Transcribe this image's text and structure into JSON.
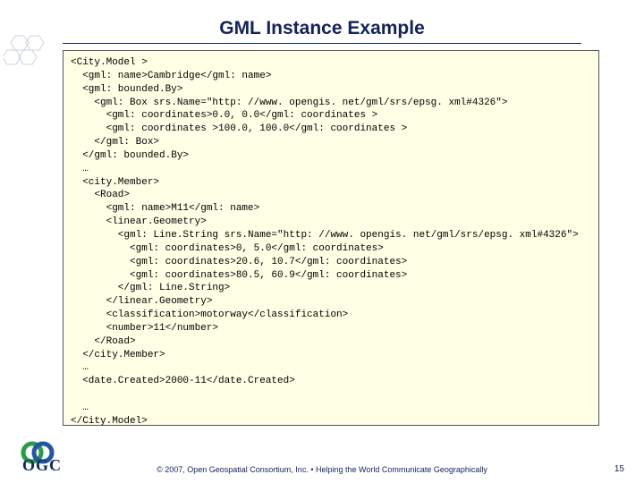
{
  "title": "GML Instance Example",
  "code": "<City.Model >\n  <gml: name>Cambridge</gml: name>\n  <gml: bounded.By>\n    <gml: Box srs.Name=\"http: //www. opengis. net/gml/srs/epsg. xml#4326\">\n      <gml: coordinates>0.0, 0.0</gml: coordinates >\n      <gml: coordinates >100.0, 100.0</gml: coordinates >\n    </gml: Box>\n  </gml: bounded.By>\n  …\n  <city.Member>\n    <Road>\n      <gml: name>M11</gml: name>\n      <linear.Geometry>\n        <gml: Line.String srs.Name=\"http: //www. opengis. net/gml/srs/epsg. xml#4326\">\n          <gml: coordinates>0, 5.0</gml: coordinates>\n          <gml: coordinates>20.6, 10.7</gml: coordinates>\n          <gml: coordinates>80.5, 60.9</gml: coordinates>\n        </gml: Line.String>\n      </linear.Geometry>\n      <classification>motorway</classification>\n      <number>11</number>\n    </Road>\n  </city.Member>\n  …\n  <date.Created>2000-11</date.Created>\n\n  …\n</City.Model>",
  "footer": "© 2007, Open Geospatial Consortium, Inc. • Helping the World Communicate Geographically",
  "page_number": "15",
  "logo_text": "OGC"
}
